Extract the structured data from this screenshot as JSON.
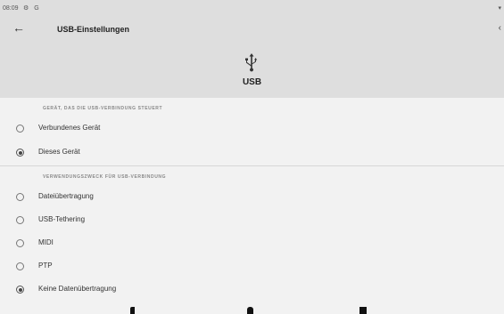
{
  "status_bar": {
    "time": "08:09",
    "icons": "⚙ G",
    "battery": "▾"
  },
  "app_bar": {
    "back_icon": "arrow-back-icon",
    "title": "USB-Einstellungen",
    "more_icon": "more-icon"
  },
  "header": {
    "icon": "usb-icon",
    "label": "USB"
  },
  "section_controller": {
    "title": "GERÄT, DAS DIE USB-VERBINDUNG STEUERT",
    "options": [
      {
        "label": "Verbundenes Gerät",
        "selected": false
      },
      {
        "label": "Dieses Gerät",
        "selected": true
      }
    ]
  },
  "section_purpose": {
    "title": "VERWENDUNGSZWECK FÜR USB-VERBINDUNG",
    "options": [
      {
        "label": "Dateiübertragung",
        "selected": false
      },
      {
        "label": "USB-Tethering",
        "selected": false
      },
      {
        "label": "MIDI",
        "selected": false
      },
      {
        "label": "PTP",
        "selected": false
      },
      {
        "label": "Keine Datenübertragung",
        "selected": true
      }
    ]
  },
  "colors": {
    "header_bg": "#dedede",
    "page_bg": "#f2f2f2",
    "radio": "#555555"
  }
}
